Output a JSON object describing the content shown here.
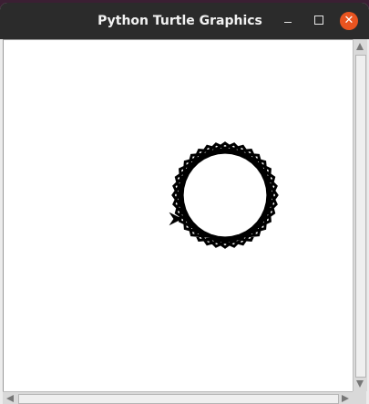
{
  "window": {
    "title": "Python Turtle Graphics",
    "minimize_label": "–",
    "close_label": "✕"
  },
  "canvas": {
    "background": "#ffffff",
    "pen_color": "#000000",
    "drawing": {
      "shape": "star-spiral",
      "points": 36
    },
    "turtle": {
      "icon": "turtle-arrow-icon",
      "heading": "right"
    }
  },
  "colors": {
    "titlebar": "#2b2b2b",
    "close_button": "#e95420",
    "scrollbar": "#d9d9d9"
  }
}
